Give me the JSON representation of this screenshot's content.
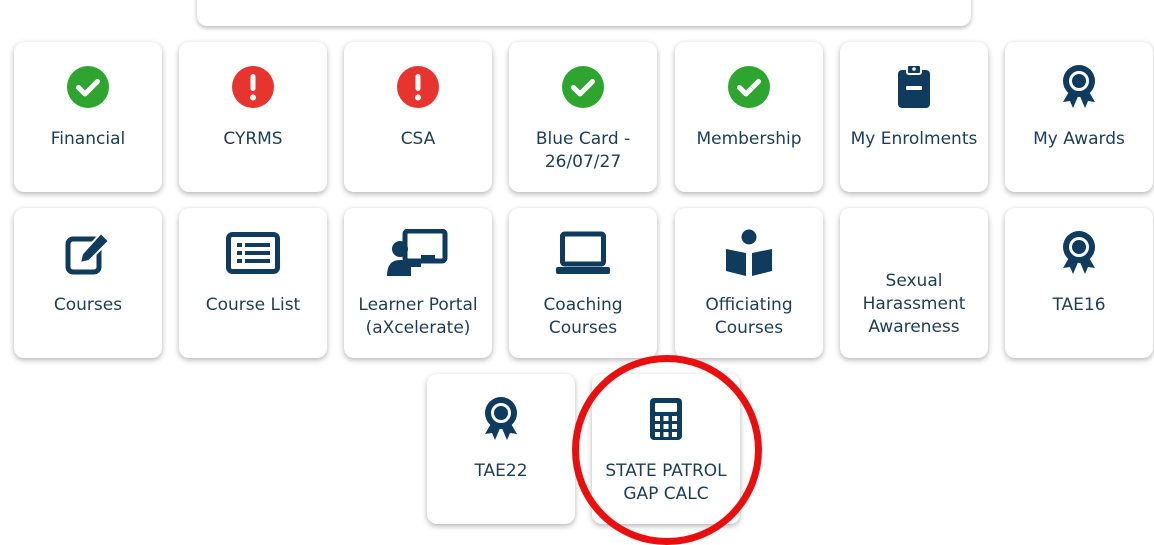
{
  "colors": {
    "ok": "#2ea52f",
    "alert": "#e8342f",
    "icon_navy": "#0f3b5e",
    "text": "#1d3c57",
    "annotation": "#ea0f0f"
  },
  "tiles": [
    {
      "label": "Financial",
      "icon": "check-circle-icon"
    },
    {
      "label": "CYRMS",
      "icon": "exclamation-circle-icon"
    },
    {
      "label": "CSA",
      "icon": "exclamation-circle-icon"
    },
    {
      "label": "Blue Card -\n26/07/27",
      "icon": "check-circle-icon"
    },
    {
      "label": "Membership",
      "icon": "check-circle-icon"
    },
    {
      "label": "My Enrolments",
      "icon": "clipboard-icon"
    },
    {
      "label": "My Awards",
      "icon": "award-icon"
    },
    {
      "label": "Courses",
      "icon": "edit-icon"
    },
    {
      "label": "Course List",
      "icon": "list-icon"
    },
    {
      "label": "Learner Portal\n(aXcelerate)",
      "icon": "presenter-icon"
    },
    {
      "label": "Coaching\nCourses",
      "icon": "laptop-icon"
    },
    {
      "label": "Officiating\nCourses",
      "icon": "book-reader-icon"
    },
    {
      "label": "Sexual\nHarassment\nAwareness",
      "icon": ""
    },
    {
      "label": "TAE16",
      "icon": "award-icon"
    },
    {
      "label": "TAE22",
      "icon": "award-icon"
    },
    {
      "label": "STATE PATROL\nGAP CALC",
      "icon": "calculator-icon"
    }
  ]
}
